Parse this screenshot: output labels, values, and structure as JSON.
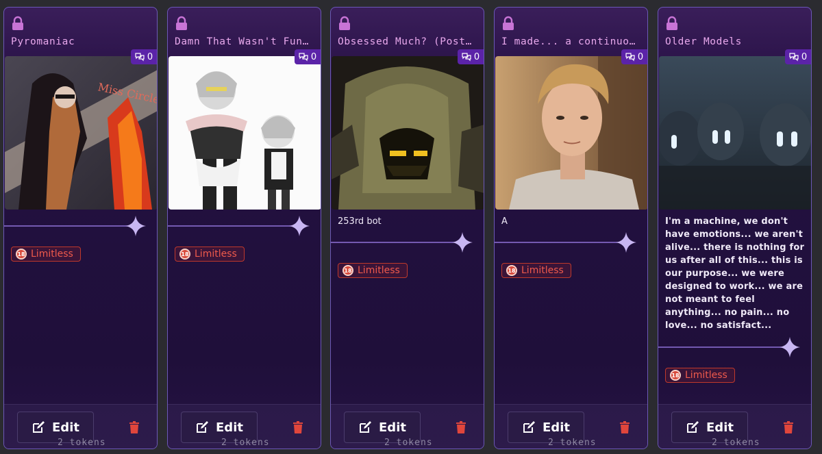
{
  "cards": [
    {
      "title": "Pyromaniac",
      "chat_count": "0",
      "description": "",
      "tag": "Limitless",
      "edit_label": "Edit",
      "tokens": "2 tokens"
    },
    {
      "title": "Damn That Wasn't Funny",
      "chat_count": "0",
      "description": "",
      "tag": "Limitless",
      "edit_label": "Edit",
      "tokens": "2 tokens"
    },
    {
      "title": "Obsessed Much? (Post-...",
      "chat_count": "0",
      "description": "253rd bot",
      "tag": "Limitless",
      "edit_label": "Edit",
      "tokens": "2 tokens"
    },
    {
      "title": "I made... a continuous l...",
      "chat_count": "0",
      "description": "A",
      "tag": "Limitless",
      "edit_label": "Edit",
      "tokens": "2 tokens"
    },
    {
      "title": "Older Models",
      "chat_count": "0",
      "description": "I'm a machine, we don't have emotions... we aren't alive... there is nothing for us after all of this... this is our purpose... we were designed to work... we are not meant to feel anything... no pain... no love... no satisfact...",
      "tag": "Limitless",
      "edit_label": "Edit",
      "tokens": "2 tokens"
    }
  ],
  "icons": {
    "lock": "lock-icon",
    "chat": "chat-bubbles-icon",
    "age": "18-plus-icon",
    "edit": "edit-icon",
    "trash": "trash-icon"
  },
  "age_badge": "18",
  "colors": {
    "accent": "#6c58b8",
    "title": "#e8a8ec",
    "tag": "#ef5a4c",
    "badge": "#5b23a8",
    "trash": "#e0463c"
  }
}
